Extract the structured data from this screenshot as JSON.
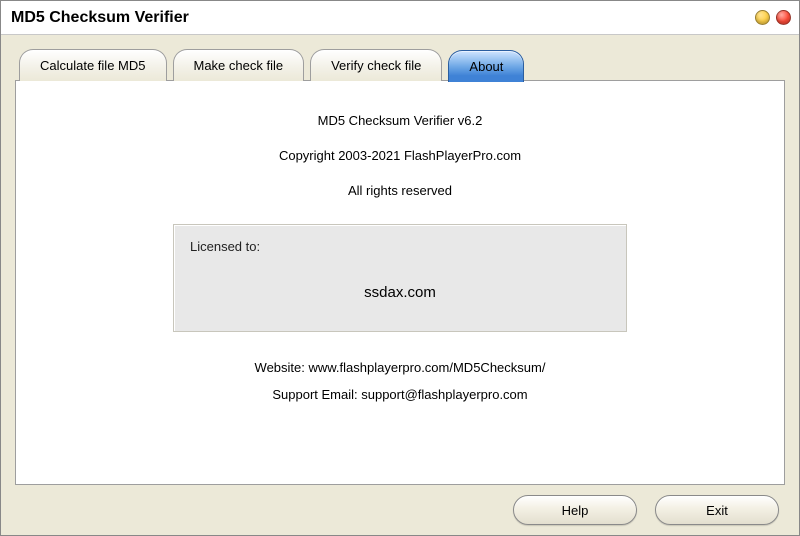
{
  "window": {
    "title": "MD5 Checksum Verifier"
  },
  "tabs": {
    "calculate": "Calculate file MD5",
    "make": "Make check file",
    "verify": "Verify check file",
    "about": "About"
  },
  "about": {
    "product": "MD5 Checksum Verifier v6.2",
    "copyright": "Copyright 2003-2021 FlashPlayerPro.com",
    "rights": "All rights reserved",
    "license_label": "Licensed to:",
    "licensee": "ssdax.com",
    "website": "Website: www.flashplayerpro.com/MD5Checksum/",
    "support": "Support Email: support@flashplayerpro.com"
  },
  "buttons": {
    "help": "Help",
    "exit": "Exit"
  }
}
